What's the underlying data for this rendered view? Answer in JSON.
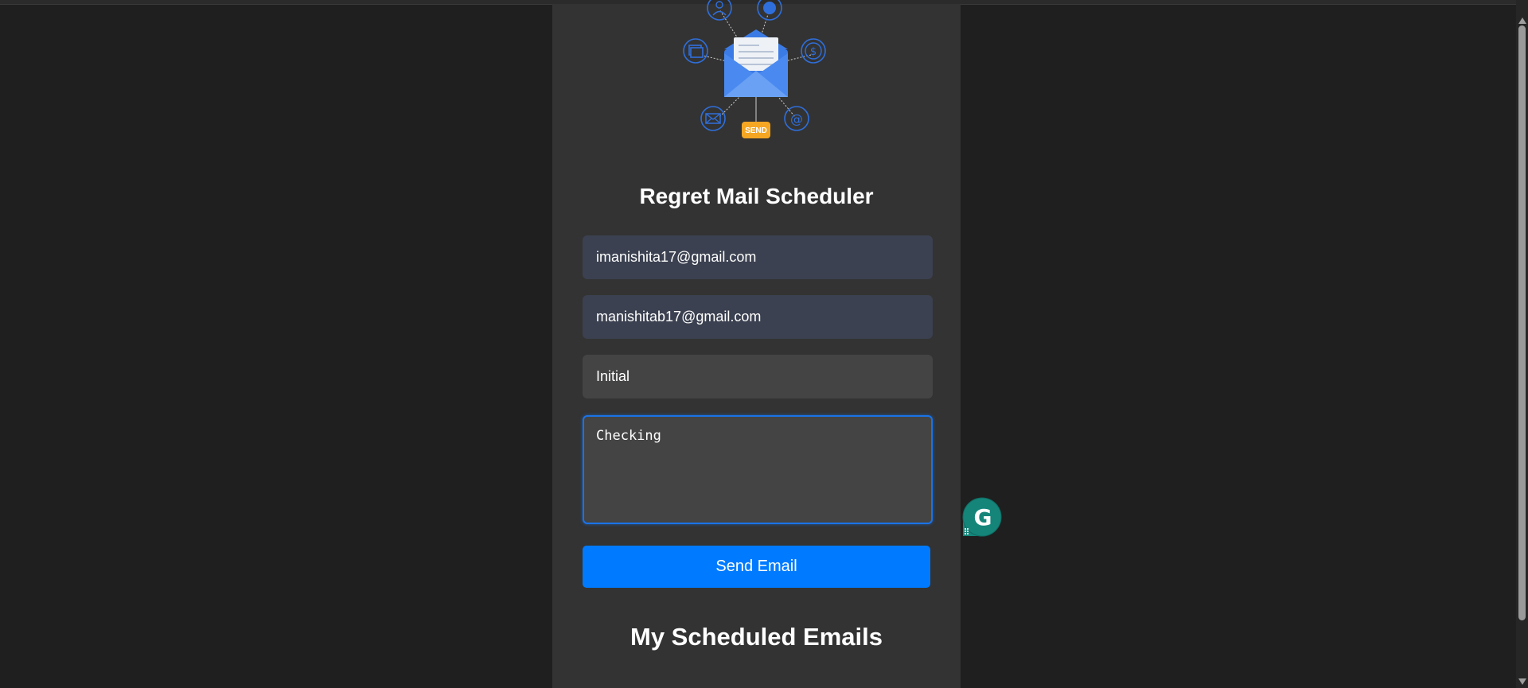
{
  "app": {
    "title": "Regret Mail Scheduler",
    "hero_badge": "SEND"
  },
  "form": {
    "from_email": "imanishita17@gmail.com",
    "to_email": "manishitab17@gmail.com",
    "subject": "Initial",
    "message": "Checking",
    "send_label": "Send Email"
  },
  "scheduled": {
    "heading": "My Scheduled Emails"
  },
  "colors": {
    "page_bg": "#1f1f1f",
    "panel_bg": "#333333",
    "accent": "#007bff",
    "autofill_bg": "#3b4150",
    "input_bg": "#444444",
    "illustration_blue": "#2f6fdc",
    "badge": "#f5a623"
  },
  "icons": [
    "envelope-illustration",
    "user-icon",
    "globe-icon",
    "photo-icon",
    "dollar-icon",
    "mail-icon",
    "at-icon",
    "grammarly-icon"
  ]
}
